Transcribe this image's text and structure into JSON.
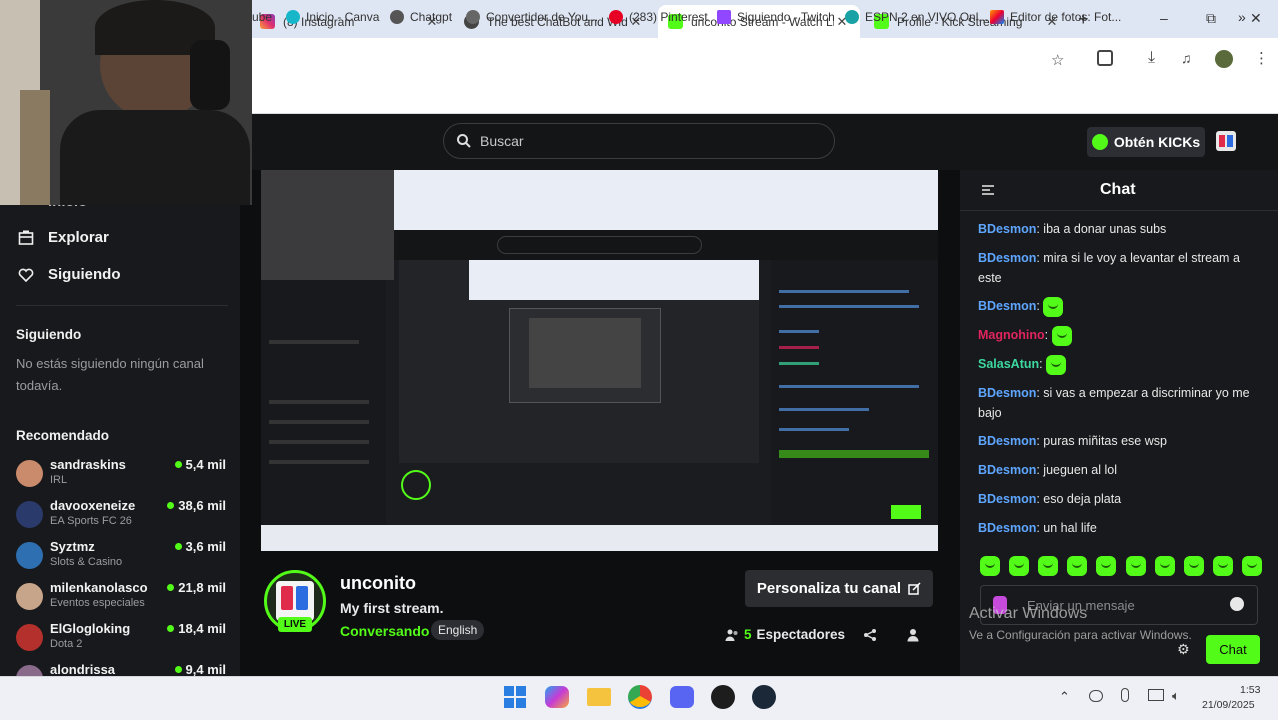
{
  "browser": {
    "tabs": [
      {
        "label": "(8) Instagram",
        "active": false
      },
      {
        "label": "The best ChatBot and Widg",
        "active": false
      },
      {
        "label": "unconito Stream - Watch Li",
        "active": true
      },
      {
        "label": "Profile - Kick Streaming",
        "active": false
      }
    ],
    "new_tab_symbol": "+",
    "window_controls": {
      "minimize": "–",
      "maximize": "⧉",
      "close": "✕"
    },
    "bookmarks": [
      {
        "label": "ube"
      },
      {
        "label": "Inicio - Canva"
      },
      {
        "label": "Chatgpt"
      },
      {
        "label": "Convertidor de You..."
      },
      {
        "label": "(283) Pinterest"
      },
      {
        "label": "Siguiendo - Twitch"
      },
      {
        "label": "ESPN 2 en VIVO Onl..."
      },
      {
        "label": "Editor de fotos: Fot..."
      }
    ],
    "bookmarks_more": "»"
  },
  "header": {
    "search_placeholder": "Buscar",
    "kicks_button": "Obtén KICKs"
  },
  "sidebar": {
    "partial_item": "Inicio",
    "nav": [
      {
        "label": "Explorar",
        "icon": "explore-icon"
      },
      {
        "label": "Siguiendo",
        "icon": "heart-icon"
      }
    ],
    "following_title": "Siguiendo",
    "following_empty_line1": "No estás siguiendo ningún canal",
    "following_empty_line2": "todavía.",
    "recommended_title": "Recomendado",
    "recommended": [
      {
        "name": "sandraskins",
        "category": "IRL",
        "viewers": "5,4 mil",
        "color": "#c98b6b"
      },
      {
        "name": "davooxeneize",
        "category": "EA Sports FC 26",
        "viewers": "38,6 mil",
        "color": "#2a3a6a"
      },
      {
        "name": "Syztmz",
        "category": "Slots & Casino",
        "viewers": "3,6 mil",
        "color": "#2d6fb0"
      },
      {
        "name": "milenkanolasco",
        "category": "Eventos especiales",
        "viewers": "21,8 mil",
        "color": "#c7a58a"
      },
      {
        "name": "ElGlogloking",
        "category": "Dota 2",
        "viewers": "18,4 mil",
        "color": "#b3302c"
      },
      {
        "name": "alondrissa",
        "category": "",
        "viewers": "9,4 mil",
        "color": "#8a6a8a"
      }
    ]
  },
  "stream": {
    "channel": "unconito",
    "title": "My first stream.",
    "category": "Conversando",
    "language": "English",
    "live_label": "LIVE",
    "customize_button": "Personaliza tu canal",
    "viewers_count": "5",
    "viewers_label": "Espectadores"
  },
  "chat": {
    "title": "Chat",
    "messages": [
      {
        "user": "BDesmon",
        "user_color": "#5ea6ff",
        "text": "iba a donar unas subs",
        "emote": false
      },
      {
        "user": "BDesmon",
        "user_color": "#5ea6ff",
        "text": "mira si le voy a levantar el stream a este",
        "emote": false
      },
      {
        "user": "BDesmon",
        "user_color": "#5ea6ff",
        "text": "",
        "emote": true
      },
      {
        "user": "Magnohino",
        "user_color": "#e0245e",
        "text": "",
        "emote": true
      },
      {
        "user": "SalasAtun",
        "user_color": "#3cd9a0",
        "text": "",
        "emote": true
      },
      {
        "user": "BDesmon",
        "user_color": "#5ea6ff",
        "text": "si vas a empezar a discriminar yo me bajo",
        "emote": false
      },
      {
        "user": "BDesmon",
        "user_color": "#5ea6ff",
        "text": "puras miñitas ese wsp",
        "emote": false
      },
      {
        "user": "BDesmon",
        "user_color": "#5ea6ff",
        "text": "jueguen al lol",
        "emote": false
      },
      {
        "user": "BDesmon",
        "user_color": "#5ea6ff",
        "text": "eso deja plata",
        "emote": false
      },
      {
        "user": "BDesmon",
        "user_color": "#5ea6ff",
        "text": "un hal life",
        "emote": false
      }
    ],
    "input_placeholder": "Enviar un mensaje",
    "send_button": "Chat",
    "watermark_title": "Activar Windows",
    "watermark_sub": "Ve a Configuración para activar Windows."
  },
  "taskbar": {
    "time": "1:53",
    "date": "21/09/2025"
  },
  "colors": {
    "kick_green": "#53fc18",
    "chat_user": "#5ea6ff"
  }
}
